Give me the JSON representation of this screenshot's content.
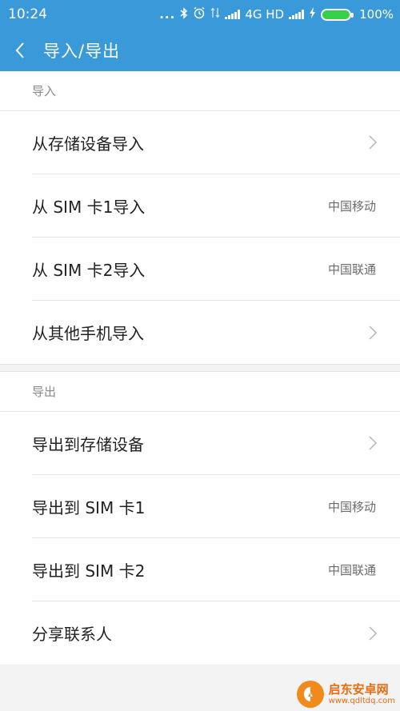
{
  "status_bar": {
    "time": "10:24",
    "dots": "...",
    "network": "4G HD",
    "battery_percent": "100%"
  },
  "app_bar": {
    "title": "导入/导出"
  },
  "import_section": {
    "header": "导入",
    "items": [
      {
        "label": "从存储设备导入",
        "value": ""
      },
      {
        "label": "从 SIM 卡1导入",
        "value": "中国移动"
      },
      {
        "label": "从 SIM 卡2导入",
        "value": "中国联通"
      },
      {
        "label": "从其他手机导入",
        "value": ""
      }
    ]
  },
  "export_section": {
    "header": "导出",
    "items": [
      {
        "label": "导出到存储设备",
        "value": ""
      },
      {
        "label": "导出到 SIM 卡1",
        "value": "中国移动"
      },
      {
        "label": "导出到 SIM 卡2",
        "value": "中国联通"
      },
      {
        "label": "分享联系人",
        "value": ""
      }
    ]
  },
  "watermark": {
    "name": "启东安卓网",
    "url": "www.qdltdq.com"
  },
  "colors": {
    "accent": "#3a9ad9",
    "battery": "#35d14a"
  }
}
